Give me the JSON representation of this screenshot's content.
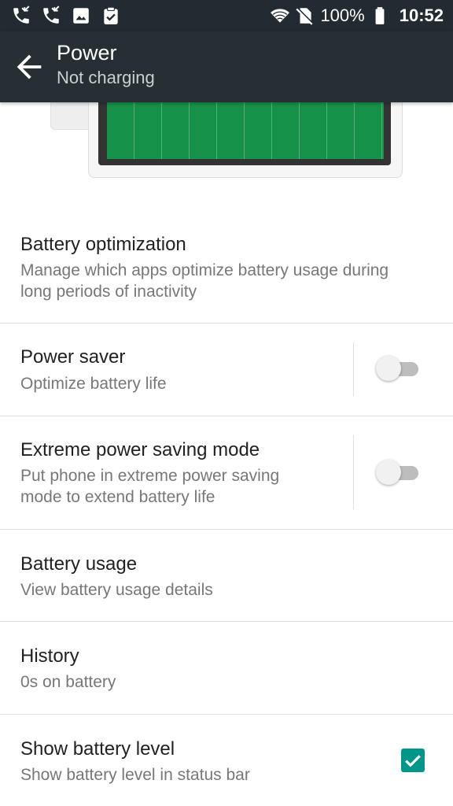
{
  "status_bar": {
    "battery_percent": "100%",
    "time": "10:52",
    "left_icons": [
      "missed-call-icon",
      "missed-call-icon",
      "image-icon",
      "clipboard-check-icon"
    ],
    "right_icons": [
      "wifi-icon",
      "no-sim-icon",
      "battery-full-icon"
    ]
  },
  "app_bar": {
    "title": "Power",
    "subtitle": "Not charging"
  },
  "illustration": {
    "battery_fill_level": 1.0,
    "fill_color": "#17924a"
  },
  "settings": {
    "battery_optimization": {
      "title": "Battery optimization",
      "subtitle_line1": "Manage which apps optimize battery usage during",
      "subtitle_line2": "long periods of inactivity"
    },
    "power_saver": {
      "title": "Power saver",
      "subtitle": "Optimize battery life",
      "enabled": false
    },
    "extreme_power_saving": {
      "title": "Extreme power saving mode",
      "subtitle_line1": "Put phone in extreme power saving",
      "subtitle_line2": "mode to extend battery life",
      "enabled": false
    },
    "battery_usage": {
      "title": "Battery usage",
      "subtitle": "View battery usage details"
    },
    "history": {
      "title": "History",
      "subtitle": "0s on battery"
    },
    "show_battery_level": {
      "title": "Show battery level",
      "subtitle": "Show battery level in status bar",
      "checked": true
    }
  },
  "colors": {
    "status_bar_bg": "#212b31",
    "app_bar_bg": "#262f34",
    "accent": "#00968a",
    "battery_green": "#17924a"
  }
}
